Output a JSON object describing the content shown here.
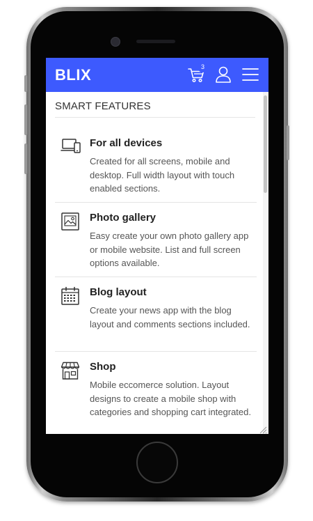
{
  "header": {
    "brand": "BLIX",
    "cart_count": "3",
    "accent": "#3d5afe"
  },
  "section": {
    "title": "SMART FEATURES"
  },
  "features": [
    {
      "icon": "devices-icon",
      "title": "For all devices",
      "description": "Created for all screens, mobile and desktop. Full width layout with touch enabled sections."
    },
    {
      "icon": "photo-gallery-icon",
      "title": "Photo gallery",
      "description": "Easy create your own photo gallery app or mobile website. List and full screen options available."
    },
    {
      "icon": "calendar-icon",
      "title": "Blog layout",
      "description": "Create your news app with the blog layout and comments sections included."
    },
    {
      "icon": "shop-icon",
      "title": "Shop",
      "description": "Mobile eccomerce solution. Layout designs to create a mobile shop with categories and shopping cart integrated."
    }
  ]
}
